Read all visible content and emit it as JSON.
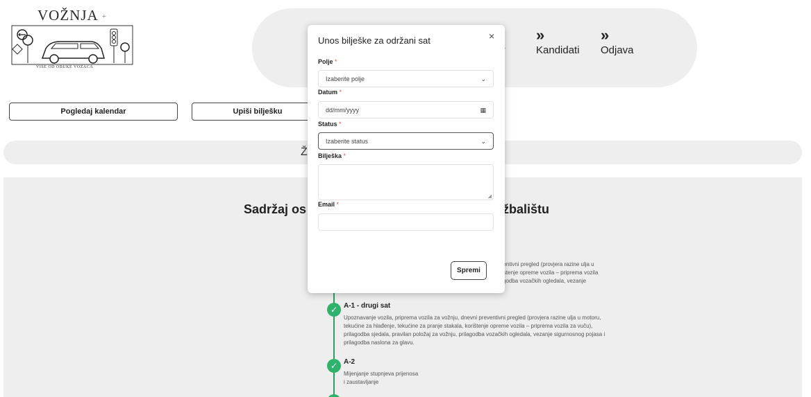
{
  "logo": {
    "title": "VOŽNJA",
    "plus": "+",
    "subtitle": "VIŠE OD OBUKE VOZAČA"
  },
  "nav": {
    "chevron": "»",
    "items": [
      {
        "label": "dar"
      },
      {
        "label": "Kandidati"
      },
      {
        "label": "Odjava"
      }
    ]
  },
  "actions": {
    "calendar_label": "Pogledaj kalendar",
    "note_label": "Upiši bilješku"
  },
  "banner": {
    "text": "Ž"
  },
  "section": {
    "title_left": "Sadržaj os",
    "title_right": "ežbalištu",
    "partial_lines": [
      "eventivni pregled (provjera razine ulja u",
      "oristenje opreme vozila – priprema vozila",
      "ilagodba vozačkih ogledala, vezanje"
    ],
    "items": [
      {
        "title": "A-1 - drugi sat",
        "desc": "Upoznavanje vozila, priprema vozila za vožnju, dnevni preventivni pregled (provjera razine ulja u motoru, tekućine za hlađenje, tekućine za pranje stakala, korištenje opreme vozila – priprema vozila za vuču), prilagodba sjedala, pravilan položaj za vožnju, prilagodba vozačkih ogledala, vezanje sigurnosnog pojasa i prilagodba naslona za glavu."
      },
      {
        "title": "A-2",
        "desc_line1": "Mijenjanje stupnjeva prijenosa",
        "desc_line2": "i zaustavljanje"
      }
    ]
  },
  "modal": {
    "title": "Unos bilješke za održani sat",
    "close": "×",
    "required_mark": "*",
    "fields": {
      "polje": {
        "label": "Polje",
        "placeholder": "Izaberite polje"
      },
      "datum": {
        "label": "Datum",
        "placeholder": "dd/mm/yyyy"
      },
      "status": {
        "label": "Status",
        "placeholder": "Izaberite status"
      },
      "biljeska": {
        "label": "Bilješka"
      },
      "email": {
        "label": "Email"
      }
    },
    "save_label": "Spremi"
  },
  "colors": {
    "accent_green": "#2fb36c",
    "nav_bg": "#eeeeee",
    "required": "#d9534f"
  }
}
